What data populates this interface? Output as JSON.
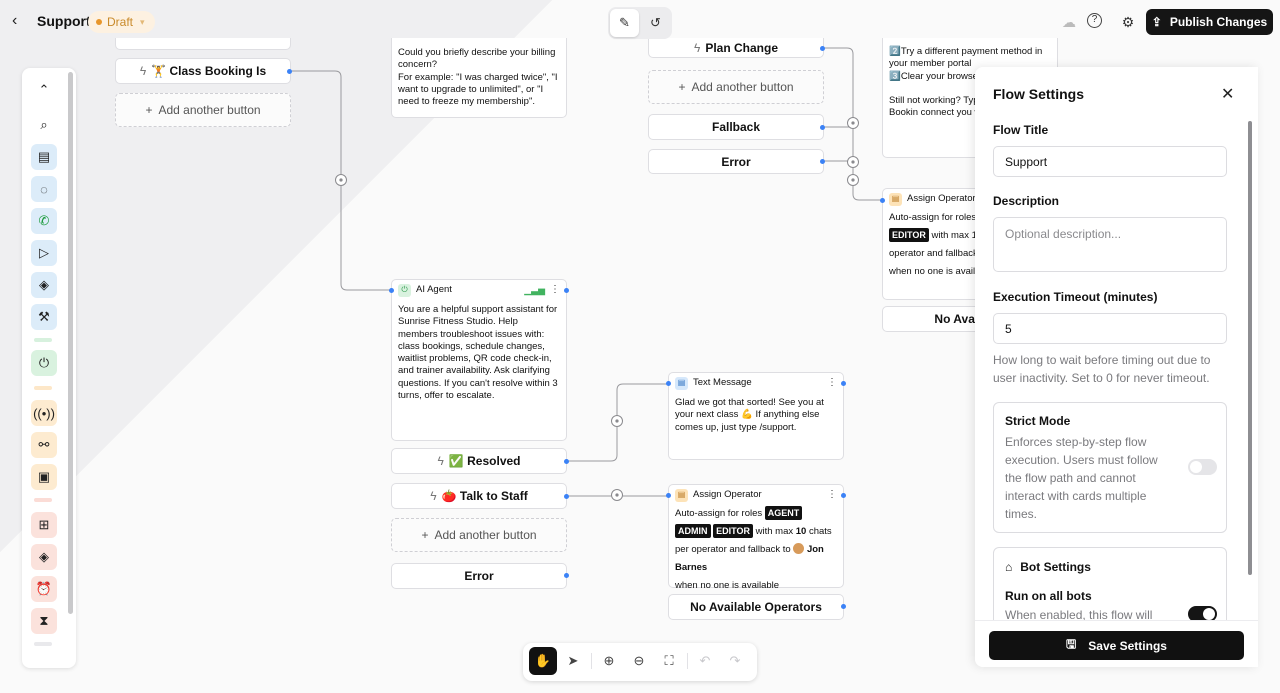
{
  "topbar": {
    "back_icon": "chevron-left-icon",
    "title": "Support",
    "status": "Draft",
    "publish_label": "Publish Changes"
  },
  "canvas": {
    "billing_text": "Could you briefly describe your billing concern?\nFor example: \"I was charged twice\", \"I want to upgrade to unlimited\", or \"I need to freeze my membership\".",
    "class_booking_button": "🏋️ Class Booking Is",
    "add_another_button": "Add another button",
    "plan_change_button": "Plan Change",
    "fallback_button": "Fallback",
    "error_button": "Error",
    "payment_text": "2️⃣Try a different payment method in your member portal\n3️⃣Clear your browse\n\nStill not working? Typ choose Class Bookin connect you with sta",
    "assign_operator_title": "Assign Operator",
    "assign_right_text1": "Auto-assign for roles",
    "assign_right_role": "EDITOR",
    "assign_right_text2": "with max 1",
    "assign_right_text3": "operator and fallback",
    "assign_right_text4": "when no one is availa",
    "no_available_short": "No Available",
    "ai_agent": {
      "title": "AI Agent",
      "body": "You are a helpful support assistant for Sunrise Fitness Studio. Help members troubleshoot issues with: class bookings, schedule changes, waitlist problems, QR code check-in, and trainer availability. Ask clarifying questions. If you can't resolve within 3 turns, offer to escalate."
    },
    "resolved_button": "✅ Resolved",
    "talk_staff_button": "🍅 Talk to Staff",
    "add_another_button2": "Add another button",
    "error_button2": "Error",
    "text_message": {
      "title": "Text Message",
      "body": "Glad we got that sorted! See you at your next class 💪 If anything else comes up, just type /support."
    },
    "assign_operator": {
      "title": "Assign Operator",
      "prefix": "Auto-assign for roles",
      "roles": [
        "AGENT",
        "ADMIN",
        "EDITOR"
      ],
      "max_prefix": "with max",
      "max_value": "10",
      "max_suffix": "chats per",
      "fallback_prefix": "operator and fallback to",
      "fallback_user": "Jon Barnes",
      "tail": "when no one is available"
    },
    "no_available_operators": "No Available Operators"
  },
  "panel": {
    "title": "Flow Settings",
    "flow_title_label": "Flow Title",
    "flow_title_value": "Support",
    "description_label": "Description",
    "description_placeholder": "Optional description...",
    "timeout_label": "Execution Timeout (minutes)",
    "timeout_value": "5",
    "timeout_help": "How long to wait before timing out due to user inactivity. Set to 0 for never timeout.",
    "strict_mode_label": "Strict Mode",
    "strict_mode_help": "Enforces step-by-step flow execution. Users must follow the flow path and cannot interact with cards multiple times.",
    "strict_mode_on": false,
    "bot_settings_label": "Bot Settings",
    "run_all_bots_label": "Run on all bots",
    "run_all_bots_help": "When enabled, this flow will",
    "run_all_bots_on": true,
    "save_label": "Save Settings"
  },
  "colors": {
    "accent_blue": "#3b82f6",
    "draft_bg": "#fdf1e1",
    "draft_text": "#c98a2a"
  }
}
